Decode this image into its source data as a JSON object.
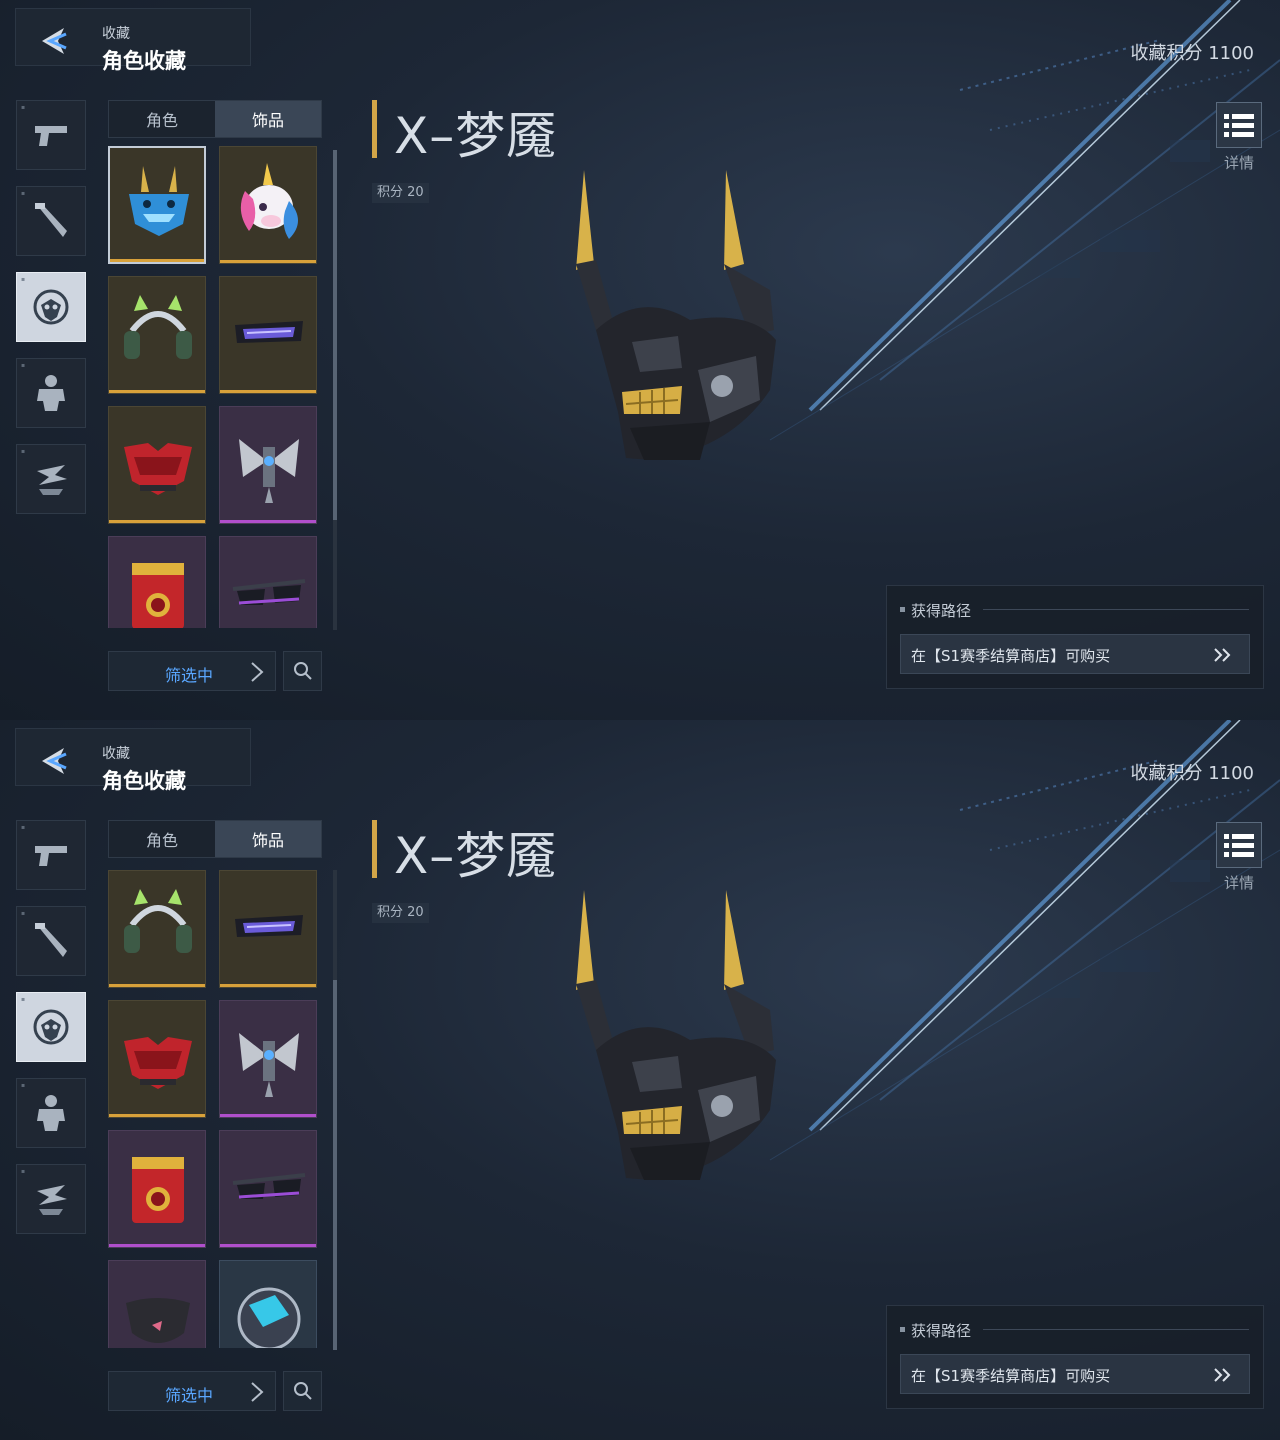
{
  "header": {
    "breadcrumb": "收藏",
    "title": "角色收藏"
  },
  "collection_points": "收藏积分 1100",
  "tabs": [
    {
      "label": "角色"
    },
    {
      "label": "饰品"
    }
  ],
  "filter": {
    "label": "筛选中"
  },
  "item": {
    "name": "X–梦魇",
    "points": "积分 20"
  },
  "details": {
    "label": "详情"
  },
  "source": {
    "title": "获得路径",
    "text": "在【S1赛季结算商店】可购买"
  },
  "categories": [
    "pistol-icon",
    "melee-weapon-icon",
    "accessory-mask-icon",
    "character-body-icon",
    "emote-icon"
  ],
  "items": [
    {
      "name": "blue-oni-mask-icon",
      "rarity": "gold"
    },
    {
      "name": "unicorn-head-icon",
      "rarity": "gold"
    },
    {
      "name": "cat-ear-headphones-icon",
      "rarity": "gold"
    },
    {
      "name": "visor-glasses-icon",
      "rarity": "gold"
    },
    {
      "name": "red-oni-mask-icon",
      "rarity": "gold"
    },
    {
      "name": "mech-wings-icon",
      "rarity": "purple"
    },
    {
      "name": "red-backpack-icon",
      "rarity": "purple"
    },
    {
      "name": "sunglasses-icon",
      "rarity": "purple"
    },
    {
      "name": "black-face-mask-icon",
      "rarity": "purple"
    },
    {
      "name": "cyber-orb-icon",
      "rarity": "blue"
    }
  ],
  "colors": {
    "accent_gold": "#d2a548",
    "accent_blue": "#5aa7ff",
    "rarity_gold": "#d8a13a",
    "rarity_purple": "#b04fcc",
    "rarity_blue": "#4d86d6"
  }
}
